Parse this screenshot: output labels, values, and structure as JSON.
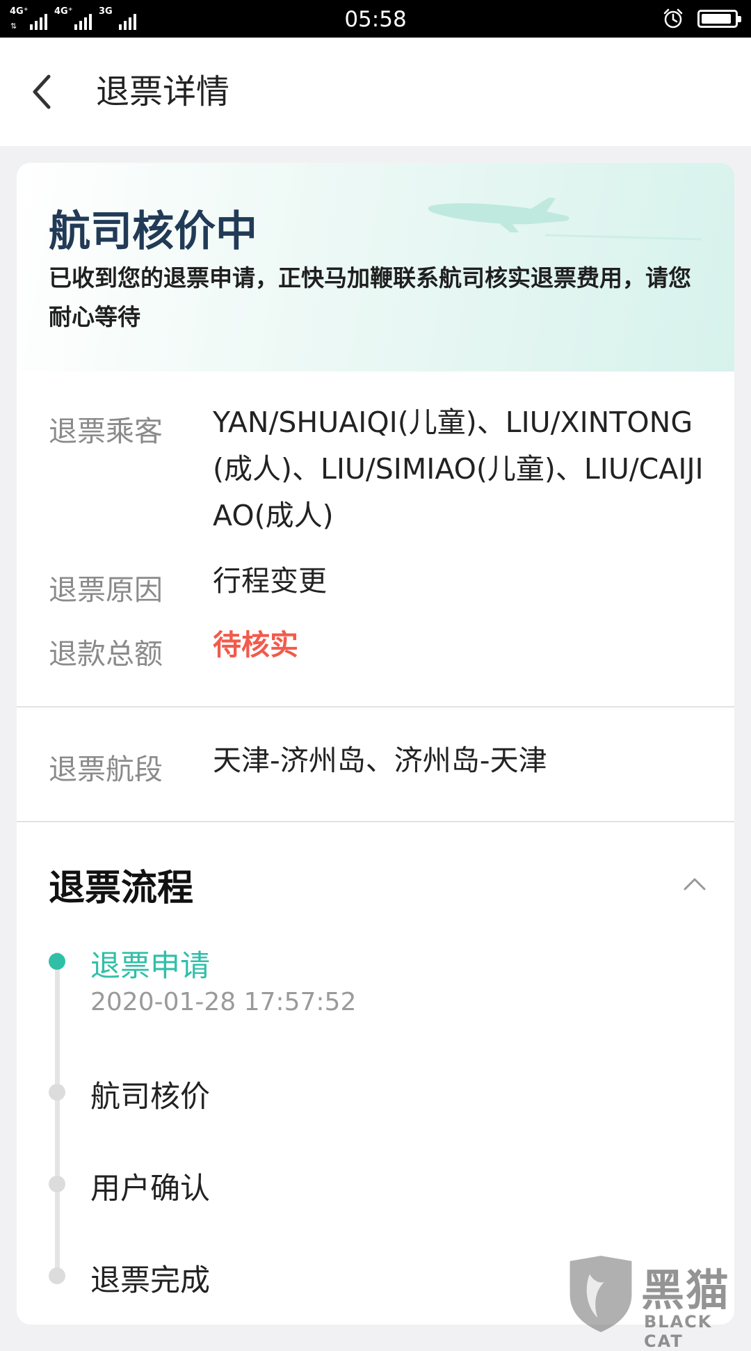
{
  "status_bar": {
    "networks": [
      "4G⁺",
      "4G⁺",
      "3G"
    ],
    "time": "05:58",
    "battery_level": 0.92
  },
  "header": {
    "title": "退票详情"
  },
  "banner": {
    "status_title": "航司核价中",
    "status_desc": "已收到您的退票申请，正快马加鞭联系航司核实退票费用，请您耐心等待"
  },
  "details": {
    "passengers": {
      "label": "退票乘客",
      "value": "YAN/SHUAIQI(儿童)、LIU/XINTONG(成人)、LIU/SIMIAO(儿童)、LIU/CAIJIAO(成人)"
    },
    "reason": {
      "label": "退票原因",
      "value": "行程变更"
    },
    "refund_total": {
      "label": "退款总额",
      "value": "待核实",
      "color": "#f25a4b"
    },
    "segments": {
      "label": "退票航段",
      "value": "天津-济州岛、济州岛-天津"
    }
  },
  "process": {
    "title": "退票流程",
    "accent_color": "#2fbfa7",
    "steps": [
      {
        "label": "退票申请",
        "time": "2020-01-28 17:57:52",
        "active": true
      },
      {
        "label": "航司核价",
        "active": false
      },
      {
        "label": "用户确认",
        "active": false
      },
      {
        "label": "退票完成",
        "active": false
      }
    ]
  },
  "watermark": {
    "text": "黑猫",
    "sub": "BLACK CAT"
  }
}
